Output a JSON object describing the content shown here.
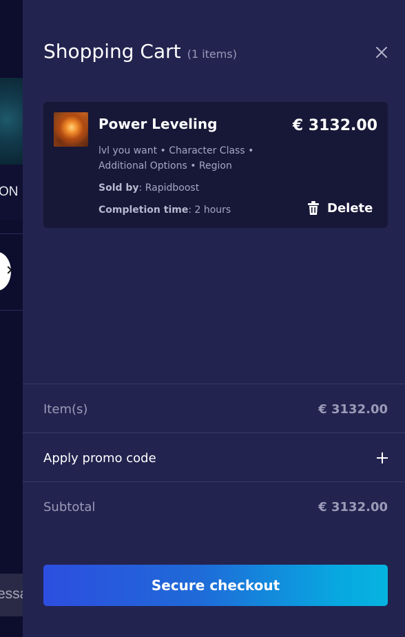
{
  "background": {
    "ribbon_text": "ON",
    "input_text": "essa"
  },
  "cart": {
    "title": "Shopping Cart",
    "count_label": "(1 items)"
  },
  "item": {
    "name": "Power Leveling",
    "price": "€ 3132.00",
    "options": "lvl you want • Character Class • Additional Options • Region",
    "sold_by_label": "Sold by",
    "sold_by_value": ": Rapidboost",
    "completion_label": "Completion time",
    "completion_value": ": 2 hours",
    "delete_label": "Delete"
  },
  "summary": {
    "items_label": "Item(s)",
    "items_value": "€ 3132.00",
    "promo_label": "Apply promo code",
    "subtotal_label": "Subtotal",
    "subtotal_value": "€ 3132.00"
  },
  "checkout": {
    "label": "Secure checkout"
  },
  "colors": {
    "drawer_bg": "#232350",
    "card_bg": "#171737",
    "page_bg": "#0d0d2e",
    "checkout_gradient_start": "#2d4ee0",
    "checkout_gradient_end": "#05b4e0"
  },
  "icons": {
    "close": "close-icon",
    "delete": "trash-icon",
    "promo": "plus-icon"
  }
}
